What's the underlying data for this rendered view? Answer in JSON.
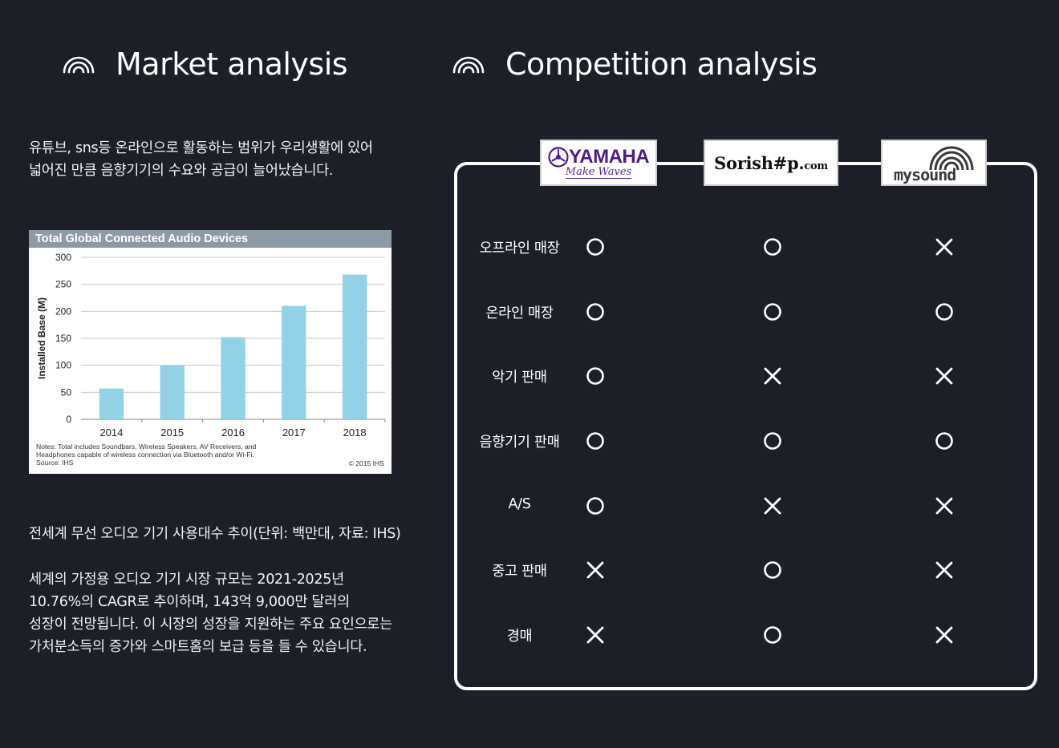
{
  "market": {
    "title": "Market analysis",
    "intro_line1": "유튜브, sns등 온라인으로 활동하는 범위가 우리생활에 있어",
    "intro_line2": "넓어진 만큼 음향기기의 수요와 공급이 늘어났습니다.",
    "caption": "전세계 무선 오디오 기기 사용대수 추이(단위: 백만대, 자료: IHS)",
    "summary_line1": "세계의 가정용 오디오 기기 시장 규모는 2021-2025년",
    "summary_line2": "10.76%의 CAGR로 추이하며, 143억 9,000만 달러의",
    "summary_line3": "성장이 전망됩니다. 이 시장의 성장을 지원하는 주요 요인으로는",
    "summary_line4": "가처분소득의 증가와 스마트홈의 보급 등을 들 수 있습니다."
  },
  "chart_data": {
    "type": "bar",
    "title": "Total Global Connected Audio Devices",
    "ylabel": "Installed Base (M)",
    "xlabel": "",
    "categories": [
      "2014",
      "2015",
      "2016",
      "2017",
      "2018"
    ],
    "values": [
      57,
      100,
      152,
      210,
      268
    ],
    "yticks": [
      "0",
      "50",
      "100",
      "150",
      "200",
      "250",
      "300"
    ],
    "ylim": [
      0,
      300
    ],
    "grid": true,
    "bar_color": "#92d1e6",
    "notes_line1": "Notes: Total includes Soundbars, Wireless Speakers, AV Receivers, and",
    "notes_line2": "Headphones capable of wireless connection via Bluetooth and/or Wi-Fi.",
    "notes_line3": "Source: IHS",
    "copyright": "© 2015 IHS"
  },
  "competition": {
    "title": "Competition analysis",
    "brands": {
      "yamaha_name": "YAMAHA",
      "yamaha_tagline": "Make Waves",
      "sorisharp_name": "Sorish#p.",
      "sorisharp_suffix": "com",
      "mysound_name": "mysound"
    },
    "rows": [
      {
        "label": "오프라인 매장",
        "marks": [
          "O",
          "O",
          "X"
        ]
      },
      {
        "label": "온라인 매장",
        "marks": [
          "O",
          "O",
          "O"
        ]
      },
      {
        "label": "악기 판매",
        "marks": [
          "O",
          "X",
          "X"
        ]
      },
      {
        "label": "음향기기 판매",
        "marks": [
          "O",
          "O",
          "O"
        ]
      },
      {
        "label": "A/S",
        "marks": [
          "O",
          "X",
          "X"
        ]
      },
      {
        "label": "중고 판매",
        "marks": [
          "X",
          "O",
          "X"
        ]
      },
      {
        "label": "경매",
        "marks": [
          "X",
          "O",
          "X"
        ]
      }
    ]
  },
  "colors": {
    "background": "#1d1f28",
    "foreground": "#ffffff",
    "yamaha_purple": "#4b1b8c",
    "chart_header": "#8c9aa5"
  },
  "icons": {
    "section": "sound-wave-icon"
  }
}
